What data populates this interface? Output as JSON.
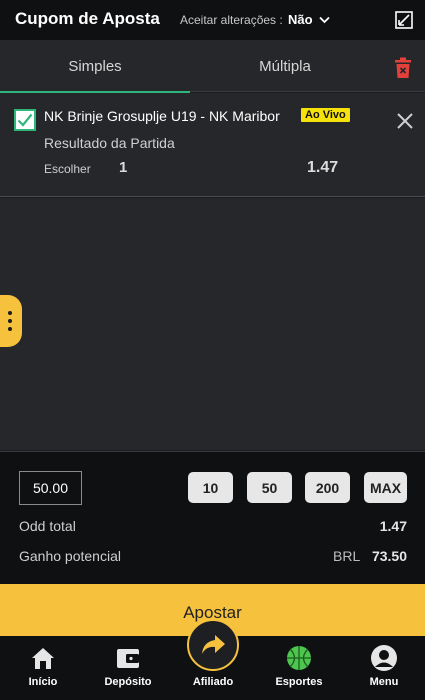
{
  "header": {
    "title": "Cupom de Aposta",
    "accept_label": "Aceitar alterações :",
    "accept_value": "Não"
  },
  "tabs": [
    {
      "label": "Simples",
      "active": true
    },
    {
      "label": "Múltipla",
      "active": false
    }
  ],
  "bet": {
    "match": "NK Brinje Grosuplje U19 - NK Maribor",
    "live_badge": "Ao Vivo",
    "market": "Resultado da Partida",
    "pick_label": "Escolher",
    "pick_value": "1",
    "odd": "1.47",
    "checked": true
  },
  "stake": {
    "value": "50.00",
    "quick_amounts": [
      "10",
      "50",
      "200",
      "MAX"
    ]
  },
  "summary": {
    "odd_total_label": "Odd total",
    "odd_total_value": "1.47",
    "potential_label": "Ganho potencial",
    "currency": "BRL",
    "potential_value": "73.50"
  },
  "submit_label": "Apostar",
  "nav": [
    {
      "label": "Início",
      "icon": "home-icon"
    },
    {
      "label": "Depósito",
      "icon": "wallet-icon"
    },
    {
      "label": "Afiliado",
      "icon": "share-icon"
    },
    {
      "label": "Esportes",
      "icon": "basketball-icon",
      "active": true
    },
    {
      "label": "Menu",
      "icon": "user-icon"
    }
  ],
  "colors": {
    "accent": "#f6c23e",
    "live": "#f5e20a",
    "tab_underline": "#2fb67a",
    "active_nav": "#4ec54f",
    "trash": "#e2403a"
  }
}
